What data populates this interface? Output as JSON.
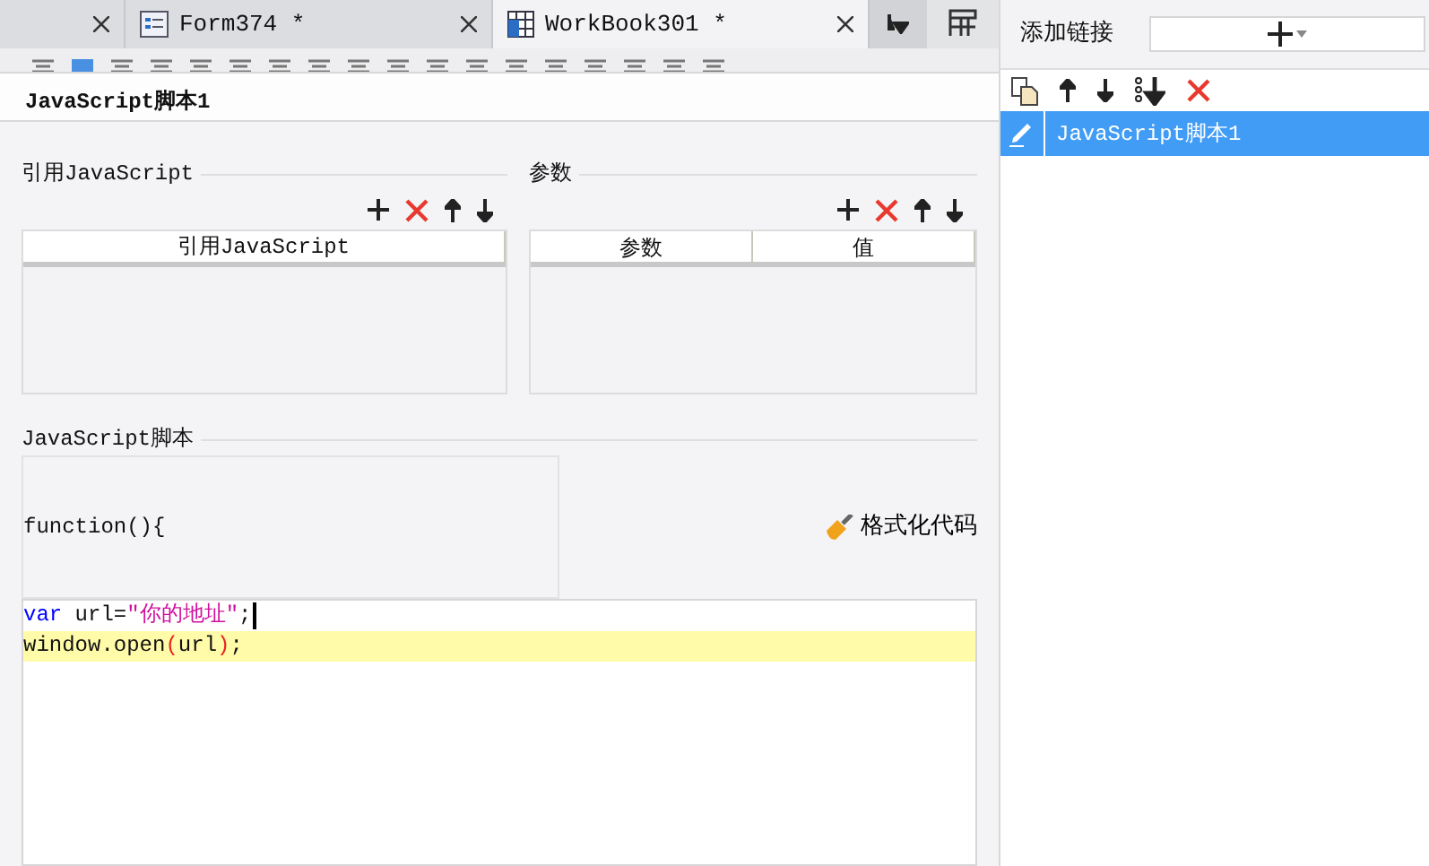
{
  "tabs": [
    {
      "label": "Form374 *",
      "selected": false
    },
    {
      "label": "WorkBook301 *",
      "selected": true
    }
  ],
  "dialog": {
    "title": "JavaScript脚本1",
    "imports": {
      "heading": "引用JavaScript",
      "columns": [
        "引用JavaScript"
      ]
    },
    "params": {
      "heading": "参数",
      "columns": [
        "参数",
        "值"
      ]
    },
    "script": {
      "heading": "JavaScript脚本",
      "signature": "function(){",
      "format_button": "格式化代码",
      "lines": [
        {
          "highlighted": false,
          "cursor": true,
          "tokens": [
            {
              "kind": "keyword",
              "text": "var"
            },
            {
              "kind": "plain",
              "text": " url="
            },
            {
              "kind": "string",
              "text": "\"你的地址\""
            },
            {
              "kind": "plain",
              "text": ";"
            }
          ]
        },
        {
          "highlighted": true,
          "cursor": false,
          "tokens": [
            {
              "kind": "plain",
              "text": "window.open"
            },
            {
              "kind": "paren",
              "text": "("
            },
            {
              "kind": "plain",
              "text": "url"
            },
            {
              "kind": "paren",
              "text": ")"
            },
            {
              "kind": "plain",
              "text": ";"
            }
          ]
        }
      ]
    }
  },
  "links_panel": {
    "label": "添加链接",
    "items": [
      {
        "label": "JavaScript脚本1",
        "selected": true
      }
    ]
  }
}
